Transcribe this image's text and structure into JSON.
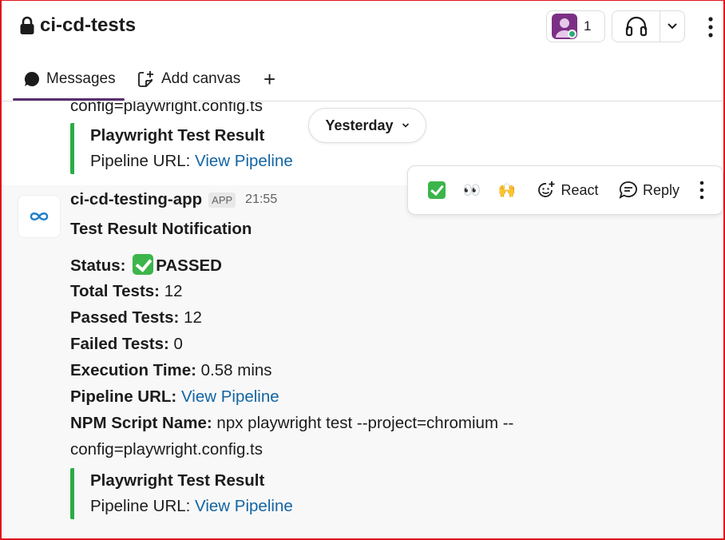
{
  "header": {
    "channel_name": "ci-cd-tests",
    "member_count": "1"
  },
  "tabs": [
    {
      "label": "Messages"
    },
    {
      "label": "Add canvas"
    },
    {
      "label": "+"
    }
  ],
  "date_divider": {
    "label": "Yesterday"
  },
  "previous_message": {
    "continuation": "config=playwright.config.ts",
    "attachment_title": "Playwright Test Result",
    "attachment_label": "Pipeline URL:",
    "attachment_link": "View Pipeline"
  },
  "message": {
    "sender": "ci-cd-testing-app",
    "badge": "APP",
    "time": "21:55",
    "heading": "Test Result Notification",
    "fields": [
      {
        "label": "Status:",
        "value": "PASSED",
        "emoji": "white-check-mark"
      },
      {
        "label": "Total Tests:",
        "value": "12"
      },
      {
        "label": "Passed Tests:",
        "value": "12"
      },
      {
        "label": "Failed Tests:",
        "value": "0"
      },
      {
        "label": "Execution Time:",
        "value": "0.58 mins"
      },
      {
        "label": "Pipeline URL:",
        "value": "View Pipeline"
      },
      {
        "label": "NPM Script Name:",
        "value": "npx playwright test --project=chromium --"
      }
    ],
    "script_continuation": "config=playwright.config.ts",
    "attachment_title": "Playwright Test Result",
    "attachment_label": "Pipeline URL:",
    "attachment_link": "View Pipeline"
  },
  "toolbar": {
    "emoji_1": "✅",
    "emoji_2": "👀",
    "emoji_3": "🙌",
    "react_label": "React",
    "reply_label": "Reply"
  },
  "colors": {
    "link": "#1264a3",
    "attachment_bar": "#2bac46",
    "tab_underline": "#5b2d6e",
    "frame": "#e0151b"
  }
}
